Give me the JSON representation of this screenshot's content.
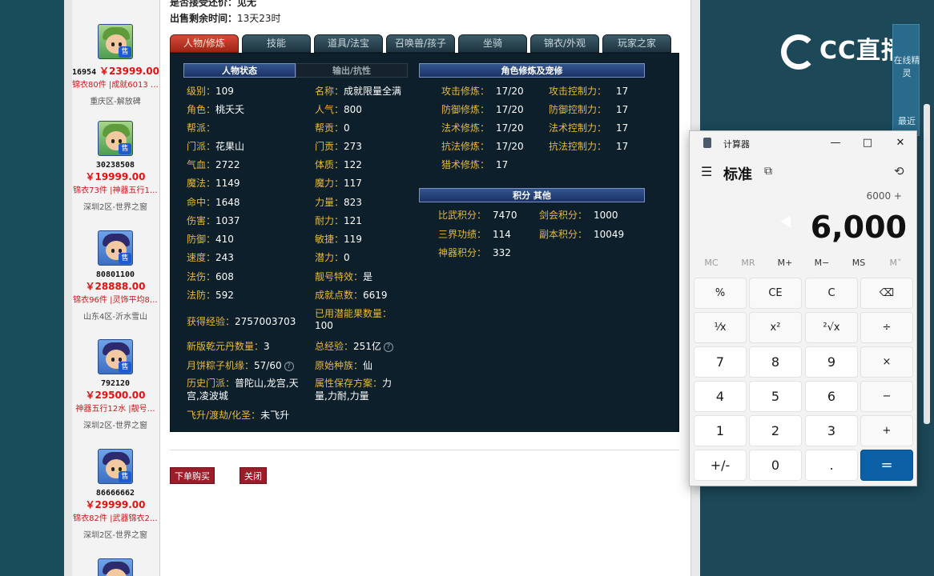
{
  "listings": [
    {
      "id": "16954",
      "price": "￥23999.00",
      "tags": "锦衣80件 |成就6013 |…",
      "server": "重庆区-解放碑"
    },
    {
      "id": "30238508",
      "price": "￥19999.00",
      "tags": "锦衣73件 |神器五行1…",
      "server": "深圳2区-世界之窗"
    },
    {
      "id": "80801100",
      "price": "￥28888.00",
      "tags": "锦衣96件 |灵饰平均8…",
      "server": "山东4区-沂水雪山"
    },
    {
      "id": "792120",
      "price": "￥29500.00",
      "tags": "神器五行12水 |靓号…",
      "server": "深圳2区-世界之窗"
    },
    {
      "id": "86666662",
      "price": "￥29999.00",
      "tags": "锦衣82件 |武器锦衣2…",
      "server": "深圳2区-世界之窗"
    }
  ],
  "avatar_badge": "售",
  "header": {
    "sale_label": "出售剩余时间：",
    "sale_value": "13天23时"
  },
  "tabs": [
    "人物/修炼",
    "技能",
    "道具/法宝",
    "召唤兽/孩子",
    "坐骑",
    "锦衣/外观",
    "玩家之家"
  ],
  "panel": {
    "sec_status": "人物状态",
    "sec_output": "输出/抗性",
    "sec_cultivation": "角色修炼及宠修",
    "sec_points": "积分  其他",
    "left_col": [
      {
        "k": "级别：",
        "v": "109"
      },
      {
        "k": "角色：",
        "v": "桃夭夭"
      },
      {
        "k": "帮派：",
        "v": ""
      },
      {
        "k": "门派：",
        "v": "花果山"
      },
      {
        "k": "气血：",
        "v": "2722"
      },
      {
        "k": "魔法：",
        "v": "1149"
      },
      {
        "k": "命中：",
        "v": "1648"
      },
      {
        "k": "伤害：",
        "v": "1037"
      },
      {
        "k": "防御：",
        "v": "410"
      },
      {
        "k": "速度：",
        "v": "243"
      },
      {
        "k": "法伤：",
        "v": "608"
      },
      {
        "k": "法防：",
        "v": "592"
      }
    ],
    "right_col": [
      {
        "k": "名称：",
        "v": "成就限量全满"
      },
      {
        "k": "人气：",
        "v": "800"
      },
      {
        "k": "帮贡：",
        "v": "0"
      },
      {
        "k": "门贡：",
        "v": "273"
      },
      {
        "k": "体质：",
        "v": "122"
      },
      {
        "k": "魔力：",
        "v": "117"
      },
      {
        "k": "力量：",
        "v": "823"
      },
      {
        "k": "耐力：",
        "v": "121"
      },
      {
        "k": "敏捷：",
        "v": "119"
      },
      {
        "k": "潜力：",
        "v": "0"
      },
      {
        "k": "靓号特效：",
        "v": "是"
      },
      {
        "k": "成就点数：",
        "v": "6619"
      }
    ],
    "exp_label": "获得经验：",
    "exp_value": "2757003703",
    "used_potential_label": "已用潜能果数量：",
    "used_potential_value": "100",
    "qianyuan_label": "新版乾元丹数量：",
    "qianyuan_value": "3",
    "total_exp_label": "总经验：",
    "total_exp_value": "251亿",
    "zongzi_label": "月饼粽子机缘：",
    "zongzi_value": "57/60",
    "race_label": "原始种族：",
    "race_value": "仙",
    "history_label": "历史门派：",
    "history_value": "普陀山,龙宫,天宫,凌波城",
    "attr_plan_label": "属性保存方案：",
    "attr_plan_value": "力量,力耐,力量",
    "ascend_label": "飞升/渡劫/化圣：",
    "ascend_value": "未飞升",
    "help_icon": "?",
    "cultivation": [
      {
        "k": "攻击修炼：",
        "v": "17/20"
      },
      {
        "k": "防御修炼：",
        "v": "17/20"
      },
      {
        "k": "法术修炼：",
        "v": "17/20"
      },
      {
        "k": "抗法修炼：",
        "v": "17/20"
      },
      {
        "k": "猎术修炼：",
        "v": "17"
      }
    ],
    "control": [
      {
        "k": "攻击控制力：",
        "v": "17"
      },
      {
        "k": "防御控制力：",
        "v": "17"
      },
      {
        "k": "法术控制力：",
        "v": "17"
      },
      {
        "k": "抗法控制力：",
        "v": "17"
      }
    ],
    "points_left": [
      {
        "k": "比武积分：",
        "v": "7470"
      },
      {
        "k": "三界功绩：",
        "v": "114"
      },
      {
        "k": "神器积分：",
        "v": "332"
      }
    ],
    "points_right": [
      {
        "k": "剑会积分：",
        "v": "1000"
      },
      {
        "k": "副本积分：",
        "v": "10049"
      }
    ]
  },
  "buttons": {
    "buy": "下单购买",
    "close": "关闭"
  },
  "overlay": {
    "cc_text": "CC直播",
    "side_tool_1": "在线精灵",
    "side_tool_2": "最近",
    "top_cut_text": "是否接受还价：见无"
  },
  "calculator": {
    "title": "计算器",
    "mode": "标准",
    "expression": "6000 +",
    "display": "6,000",
    "memory": [
      "MC",
      "MR",
      "M+",
      "M−",
      "MS",
      "M˅"
    ],
    "rows": [
      [
        "%",
        "CE",
        "C",
        "⌫"
      ],
      [
        "¹⁄x",
        "x²",
        "²√x",
        "÷"
      ],
      [
        "7",
        "8",
        "9",
        "×"
      ],
      [
        "4",
        "5",
        "6",
        "−"
      ],
      [
        "1",
        "2",
        "3",
        "+"
      ],
      [
        "+/-",
        "0",
        ".",
        "="
      ]
    ],
    "win_controls": {
      "minimize": "—",
      "maximize": "□",
      "close": "✕"
    }
  }
}
